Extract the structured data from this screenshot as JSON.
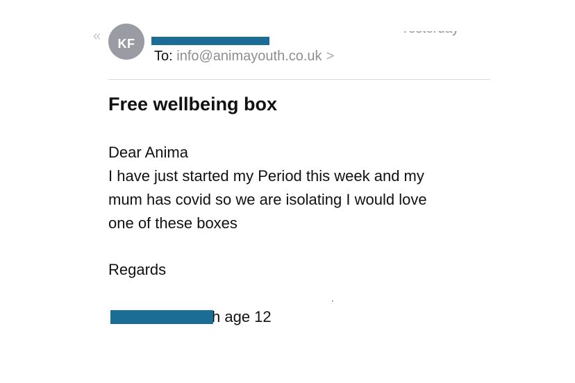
{
  "header": {
    "avatar_initials": "KF",
    "date": "Yesterday",
    "to_label": "To:",
    "to_address": "info@animayouth.co.uk",
    "to_chevron": ">",
    "back_chevron": "«"
  },
  "email": {
    "subject": "Free wellbeing box",
    "greeting": "Dear Anima",
    "body_lines": [
      "I have just started my Period this week and my",
      "mum has covid so we are isolating I would love",
      "one of these boxes"
    ],
    "signoff": "Regards",
    "signature_suffix": "h age 12"
  },
  "colors": {
    "redaction": "#1b6d95",
    "avatar": "#9a9ca3",
    "secondary_text": "#8e8e93"
  }
}
